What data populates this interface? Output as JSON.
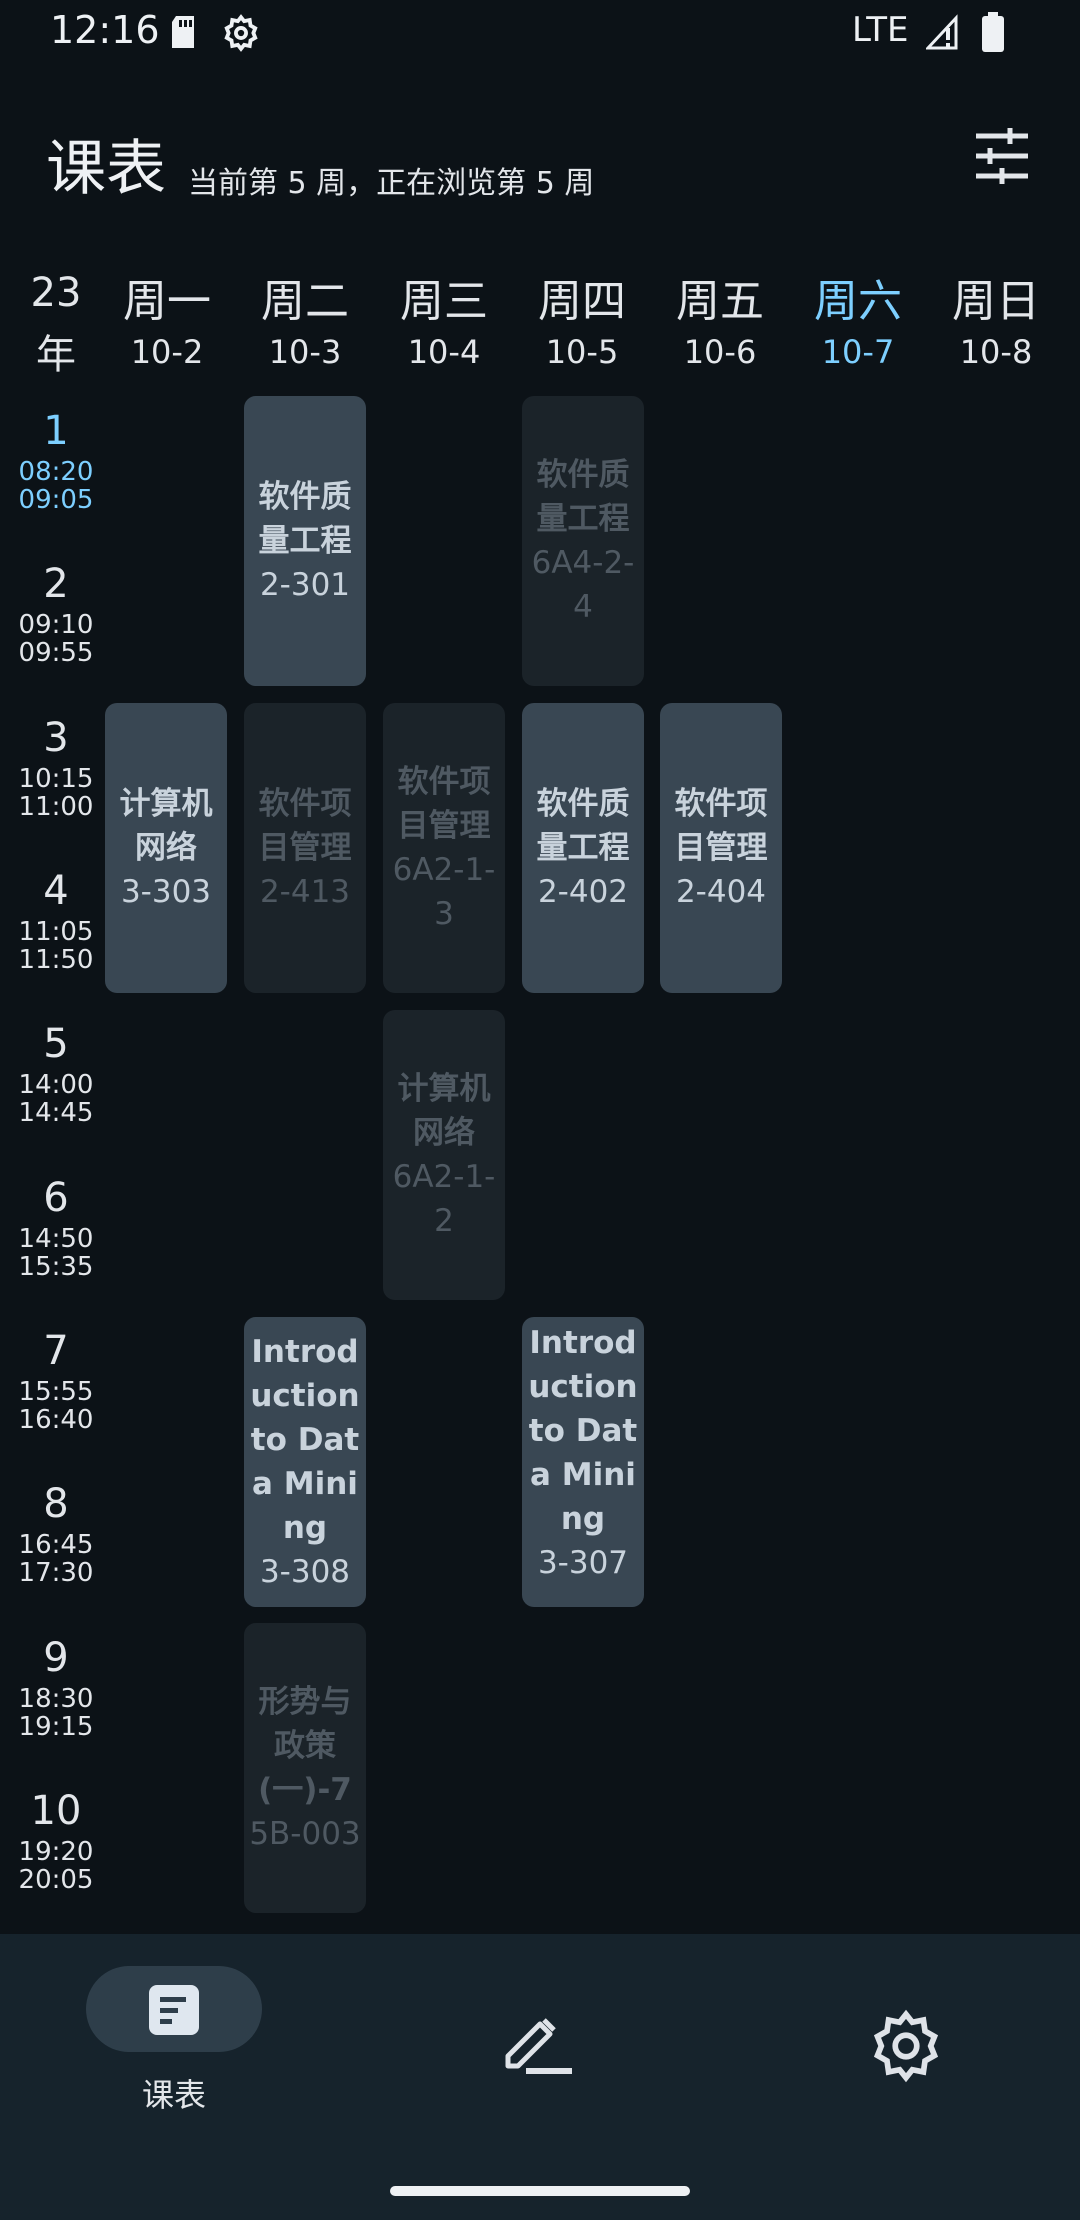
{
  "status_bar": {
    "time": "12:16",
    "network": "LTE"
  },
  "header": {
    "title": "课表",
    "subtitle": "当前第 5 周，正在浏览第 5 周"
  },
  "week": {
    "year": "23年",
    "days": [
      {
        "name": "周一",
        "date": "10-2"
      },
      {
        "name": "周二",
        "date": "10-3"
      },
      {
        "name": "周三",
        "date": "10-4"
      },
      {
        "name": "周四",
        "date": "10-5"
      },
      {
        "name": "周五",
        "date": "10-6"
      },
      {
        "name": "周六",
        "date": "10-7"
      },
      {
        "name": "周日",
        "date": "10-8"
      }
    ]
  },
  "periods": [
    {
      "num": "1",
      "start": "08:20",
      "end": "09:05"
    },
    {
      "num": "2",
      "start": "09:10",
      "end": "09:55"
    },
    {
      "num": "3",
      "start": "10:15",
      "end": "11:00"
    },
    {
      "num": "4",
      "start": "11:05",
      "end": "11:50"
    },
    {
      "num": "5",
      "start": "14:00",
      "end": "14:45"
    },
    {
      "num": "6",
      "start": "14:50",
      "end": "15:35"
    },
    {
      "num": "7",
      "start": "15:55",
      "end": "16:40"
    },
    {
      "num": "8",
      "start": "16:45",
      "end": "17:30"
    },
    {
      "num": "9",
      "start": "18:30",
      "end": "19:15"
    },
    {
      "num": "10",
      "start": "19:20",
      "end": "20:05"
    }
  ],
  "courses": [
    {
      "name": "软件质量工程",
      "room": "2-301"
    },
    {
      "name": "软件质量工程",
      "room": "6A4-2-4"
    },
    {
      "name": "计算机网络",
      "room": "3-303"
    },
    {
      "name": "软件项目管理",
      "room": "2-413"
    },
    {
      "name": "软件项目管理",
      "room": "6A2-1-3"
    },
    {
      "name": "软件质量工程",
      "room": "2-402"
    },
    {
      "name": "软件项目管理",
      "room": "2-404"
    },
    {
      "name": "计算机网络",
      "room": "6A2-1-2"
    },
    {
      "name": "Introduction to Data Mining",
      "room": "3-308"
    },
    {
      "name": "Introduction to Data Mining",
      "room": "3-307"
    },
    {
      "name": "形势与政策(一)-7",
      "room": "5B-003"
    }
  ],
  "bottom_nav": {
    "schedule_label": "课表"
  },
  "colors": {
    "background": "#0c1217",
    "accent": "#7dcfff",
    "card_active": "#394753",
    "card_inactive": "#1b2329",
    "nav_bar": "#16232c"
  }
}
